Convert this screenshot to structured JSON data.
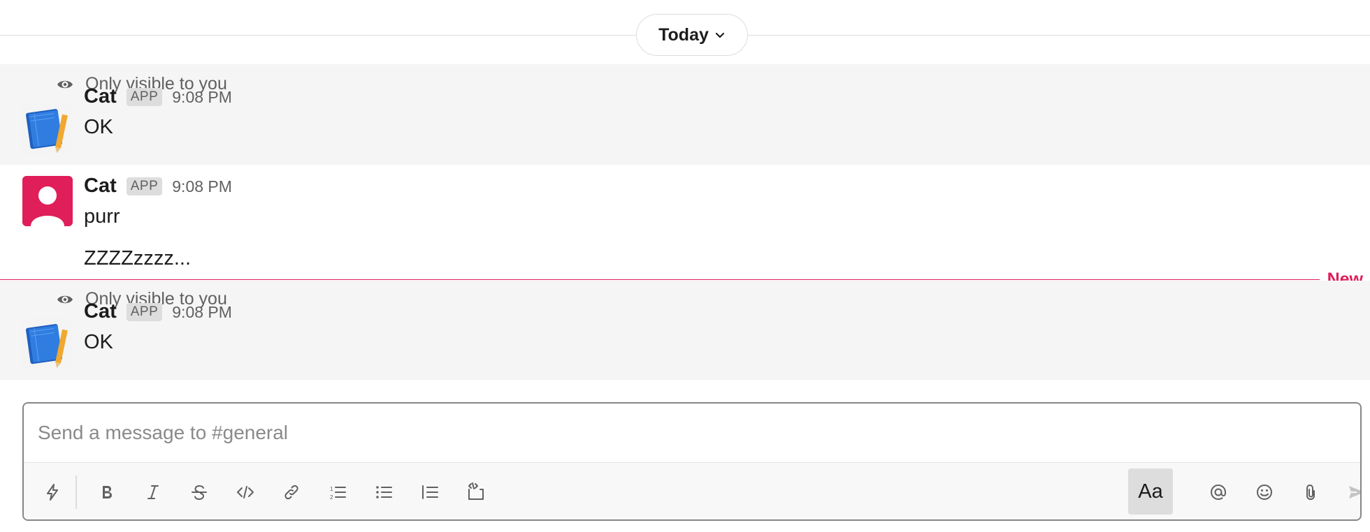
{
  "date_divider": {
    "label": "Today"
  },
  "messages": [
    {
      "ephemeral_note": "Only visible to you",
      "sender": "Cat",
      "badge": "APP",
      "time": "9:08 PM",
      "text": "OK",
      "avatar": "notebook-icon"
    },
    {
      "sender": "Cat",
      "badge": "APP",
      "time": "9:08 PM",
      "text": "purr",
      "text2": "ZZZZzzzz...",
      "avatar": "user-silhouette-icon"
    },
    {
      "ephemeral_note": "Only visible to you",
      "sender": "Cat",
      "badge": "APP",
      "time": "9:08 PM",
      "text": "OK",
      "avatar": "notebook-icon"
    }
  ],
  "new_divider": {
    "label": "New"
  },
  "composer": {
    "placeholder": "Send a message to #general",
    "format_button_label": "Aa",
    "toolbar_icons": [
      "shortcuts-icon",
      "bold-icon",
      "italic-icon",
      "strikethrough-icon",
      "code-icon",
      "link-icon",
      "ordered-list-icon",
      "bulleted-list-icon",
      "blockquote-icon",
      "code-block-icon",
      "mention-icon",
      "emoji-icon",
      "attach-icon",
      "send-icon"
    ]
  },
  "colors": {
    "accent_new": "#e01e5a",
    "ephemeral_bg": "#f5f5f5",
    "avatar_user": "#e01e5a",
    "notebook_blue": "#2f7de1"
  }
}
